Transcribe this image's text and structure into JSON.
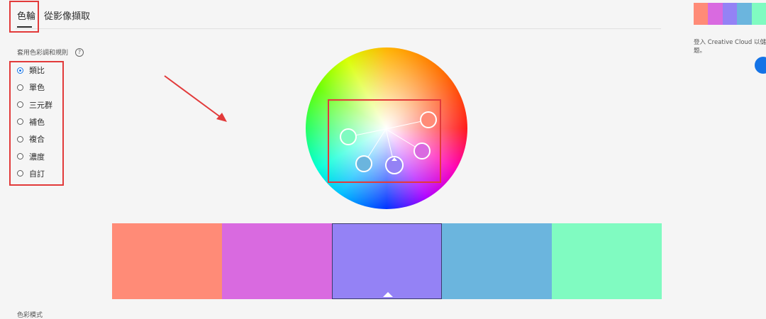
{
  "tabs": {
    "active": "色輪",
    "other": "從影像擷取"
  },
  "rule": {
    "title": "套用色彩調和規則",
    "help_icon": "?",
    "options": [
      {
        "label": "類比",
        "checked": true
      },
      {
        "label": "單色",
        "checked": false
      },
      {
        "label": "三元群",
        "checked": false
      },
      {
        "label": "補色",
        "checked": false
      },
      {
        "label": "複合",
        "checked": false
      },
      {
        "label": "濃度",
        "checked": false
      },
      {
        "label": "自訂",
        "checked": false
      }
    ]
  },
  "palette": {
    "colors": [
      "#ff8b77",
      "#d96ae0",
      "#9482f5",
      "#6bb5de",
      "#80fbc1"
    ],
    "selected_index": 2
  },
  "color_mode_label": "色彩模式",
  "sidebar": {
    "signin_text": "登入 Creative Cloud 以儲存",
    "signin_text2": "题。"
  },
  "colors": {
    "highlight": "#e23a3a",
    "accent": "#1473e6"
  }
}
